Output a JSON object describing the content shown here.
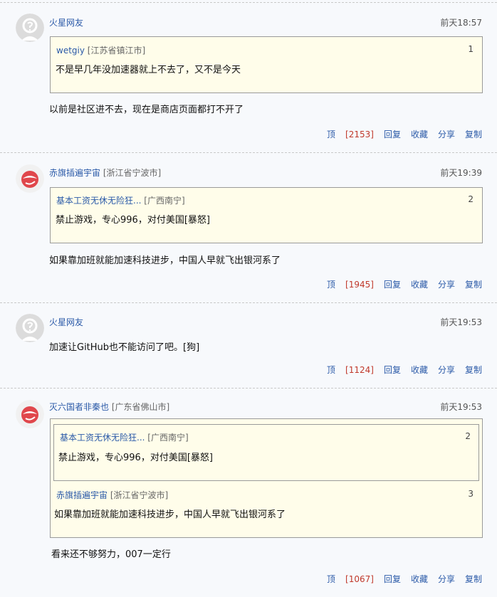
{
  "comments": [
    {
      "user": "火星网友",
      "location": "",
      "time": "前天18:57",
      "quotes": [
        {
          "user": "wetgiy",
          "location": "[江苏省镇江市]",
          "num": "1",
          "text": "不是早几年没加速器就上不去了，又不是今天"
        }
      ],
      "text": "以前是社区进不去，现在是商店页面都打不开了",
      "actions": {
        "up_label": "顶",
        "up_count": "[2153]",
        "reply": "回复",
        "fav": "收藏",
        "share": "分享",
        "copy": "复制"
      },
      "avatar": "default-avatar-icon"
    },
    {
      "user": "赤旗插遍宇宙",
      "location": "[浙江省宁波市]",
      "time": "前天19:39",
      "quotes": [
        {
          "user": "基本工资无休无险狂...",
          "location": "[广西南宁]",
          "num": "2",
          "text": "禁止游戏，专心996，对付美国[暴怒]"
        }
      ],
      "text": "如果靠加班就能加速科技进步，中国人早就飞出银河系了",
      "actions": {
        "up_label": "顶",
        "up_count": "[1945]",
        "reply": "回复",
        "fav": "收藏",
        "share": "分享",
        "copy": "复制"
      },
      "avatar": "red-logo-avatar-icon"
    },
    {
      "user": "火星网友",
      "location": "",
      "time": "前天19:53",
      "quotes": [],
      "text": "加速让GitHub也不能访问了吧。[狗]",
      "actions": {
        "up_label": "顶",
        "up_count": "[1124]",
        "reply": "回复",
        "fav": "收藏",
        "share": "分享",
        "copy": "复制"
      },
      "avatar": "default-avatar-icon"
    },
    {
      "user": "灭六国者非秦也",
      "location": "[广东省佛山市]",
      "time": "前天19:53",
      "quotes": [
        {
          "user": "基本工资无休无险狂...",
          "location": "[广西南宁]",
          "num": "2",
          "text": "禁止游戏，专心996，对付美国[暴怒]"
        },
        {
          "user": "赤旗插遍宇宙",
          "location": "[浙江省宁波市]",
          "num": "3",
          "text": "如果靠加班就能加速科技进步，中国人早就飞出银河系了"
        }
      ],
      "text": "看来还不够努力，007一定行",
      "actions": {
        "up_label": "顶",
        "up_count": "[1067]",
        "reply": "回复",
        "fav": "收藏",
        "share": "分享",
        "copy": "复制"
      },
      "avatar": "red-logo-avatar-icon"
    }
  ],
  "colors": {
    "link": "#2b5aa8",
    "count": "#c0392b",
    "quote_bg": "#fffdea",
    "page_bg": "#f7f9fc"
  }
}
